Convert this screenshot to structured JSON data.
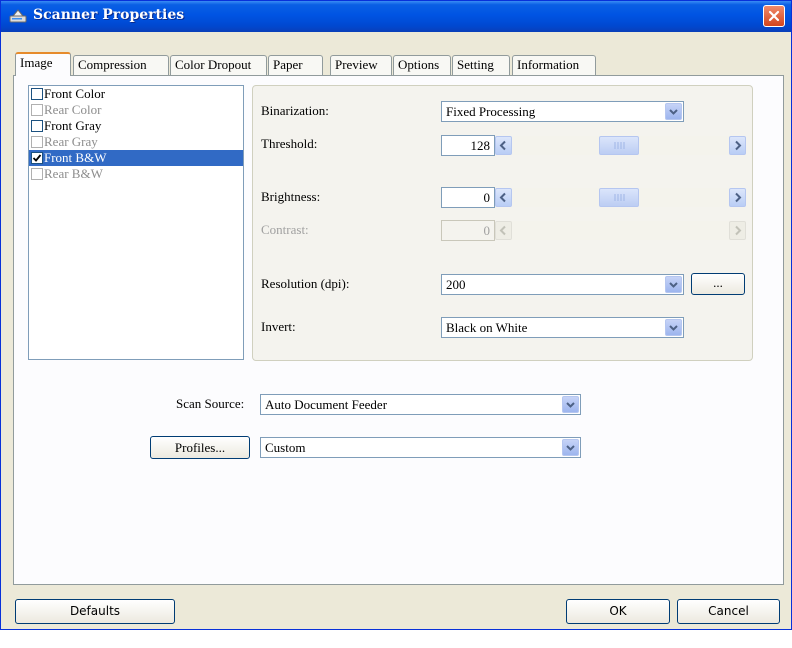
{
  "window": {
    "title": "Scanner Properties"
  },
  "tabs": [
    {
      "label": "Image",
      "active": true
    },
    {
      "label": "Compression"
    },
    {
      "label": "Color Dropout"
    },
    {
      "label": "Paper"
    },
    {
      "label": "Preview"
    },
    {
      "label": "Options"
    },
    {
      "label": "Setting"
    },
    {
      "label": "Information"
    }
  ],
  "image_list": [
    {
      "label": "Front Color",
      "checked": false,
      "enabled": true
    },
    {
      "label": "Rear Color",
      "checked": false,
      "enabled": false
    },
    {
      "label": "Front Gray",
      "checked": false,
      "enabled": true
    },
    {
      "label": "Rear Gray",
      "checked": false,
      "enabled": false
    },
    {
      "label": "Front B&W",
      "checked": true,
      "enabled": true,
      "selected": true
    },
    {
      "label": "Rear B&W",
      "checked": false,
      "enabled": false
    }
  ],
  "settings": {
    "binarization": {
      "label": "Binarization:",
      "value": "Fixed Processing"
    },
    "threshold": {
      "label": "Threshold:",
      "value": "128"
    },
    "brightness": {
      "label": "Brightness:",
      "value": "0"
    },
    "contrast": {
      "label": "Contrast:",
      "value": "0",
      "enabled": false
    },
    "resolution": {
      "label": "Resolution (dpi):",
      "value": "200",
      "more_label": "..."
    },
    "invert": {
      "label": "Invert:",
      "value": "Black on White"
    }
  },
  "scan_source": {
    "label": "Scan Source:",
    "value": "Auto Document Feeder"
  },
  "profiles": {
    "button_label": "Profiles...",
    "value": "Custom"
  },
  "footer": {
    "defaults_label": "Defaults",
    "ok_label": "OK",
    "cancel_label": "Cancel"
  },
  "colors": {
    "title_bar": "#0054e3",
    "selection": "#316ac5",
    "tab_accent": "#e68b2c",
    "face": "#ece9d8"
  },
  "icons": {
    "app": "scanner-icon",
    "close": "close-icon",
    "checkbox": "checkmark-icon",
    "dropdown": "chevron-down-icon",
    "scroll_left": "chevron-left-icon",
    "scroll_right": "chevron-right-icon"
  }
}
